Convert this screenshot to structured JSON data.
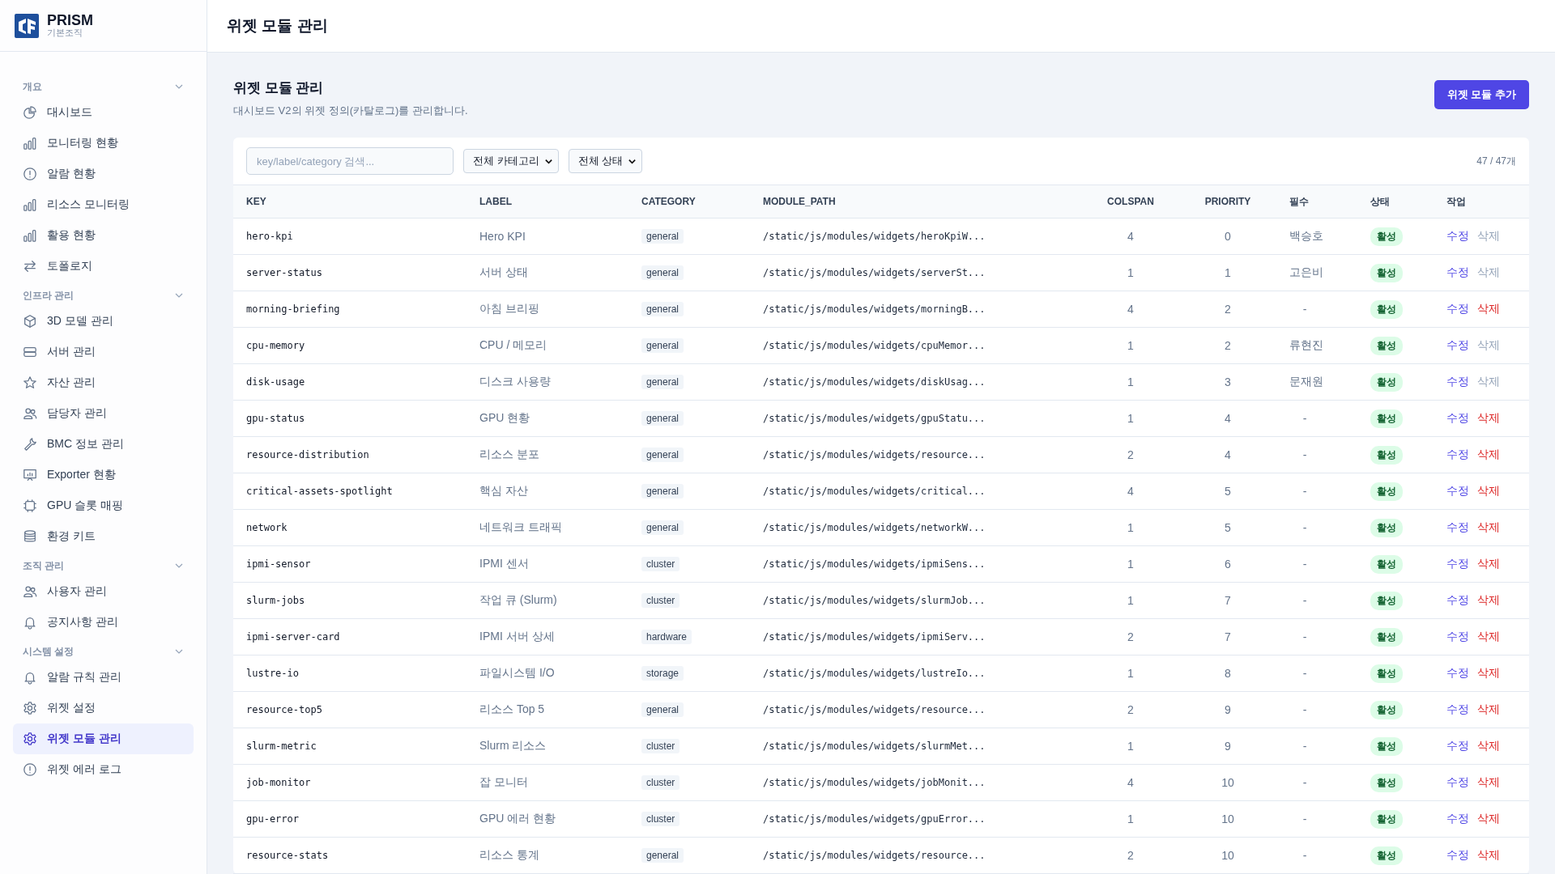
{
  "brand": {
    "name": "PRISM",
    "org": "기본조직"
  },
  "sidebar": {
    "sections": [
      {
        "title": "개요",
        "expanded": true,
        "items": [
          {
            "label": "대시보드",
            "kind": "pie",
            "selected": false
          },
          {
            "label": "모니터링 현황",
            "kind": "bars",
            "selected": false
          },
          {
            "label": "알람 현황",
            "kind": "alert",
            "selected": false
          },
          {
            "label": "리소스 모니터링",
            "kind": "bars",
            "selected": false
          },
          {
            "label": "활용 현황",
            "kind": "bars",
            "selected": false
          },
          {
            "label": "토폴로지",
            "kind": "arrows",
            "selected": false
          }
        ]
      },
      {
        "title": "인프라 관리",
        "expanded": true,
        "items": [
          {
            "label": "3D 모델 관리",
            "kind": "cube",
            "selected": false
          },
          {
            "label": "서버 관리",
            "kind": "server",
            "selected": false
          },
          {
            "label": "자산 관리",
            "kind": "star",
            "selected": false
          },
          {
            "label": "담당자 관리",
            "kind": "users",
            "selected": false
          },
          {
            "label": "BMC 정보 관리",
            "kind": "wrench",
            "selected": false
          },
          {
            "label": "Exporter 현황",
            "kind": "monitor",
            "selected": false
          },
          {
            "label": "GPU 슬롯 매핑",
            "kind": "chip",
            "selected": false
          },
          {
            "label": "환경 키트",
            "kind": "database",
            "selected": false
          }
        ]
      },
      {
        "title": "조직 관리",
        "expanded": true,
        "items": [
          {
            "label": "사용자 관리",
            "kind": "users",
            "selected": false
          },
          {
            "label": "공지사항 관리",
            "kind": "bell",
            "selected": false
          }
        ]
      },
      {
        "title": "시스템 설정",
        "expanded": true,
        "items": [
          {
            "label": "알람 규칙 관리",
            "kind": "bell",
            "selected": false
          },
          {
            "label": "위젯 설정",
            "kind": "gear",
            "selected": false
          },
          {
            "label": "위젯 모듈 관리",
            "kind": "gear",
            "selected": true
          },
          {
            "label": "위젯 에러 로그",
            "kind": "alert",
            "selected": false
          }
        ]
      }
    ]
  },
  "header": {
    "title": "위젯 모듈 관리"
  },
  "page": {
    "title": "위젯 모듈 관리",
    "description": "대시보드 V2의 위젯 정의(카탈로그)를 관리합니다.",
    "add_button": "위젯 모듈 추가"
  },
  "filters": {
    "search": {
      "placeholder": "key/label/category 검색..."
    },
    "category": "전체 카테고리",
    "status": "전체 상태",
    "count": "47 / 47개"
  },
  "table": {
    "columns": [
      "KEY",
      "LABEL",
      "CATEGORY",
      "MODULE_PATH",
      "COLSPAN",
      "PRIORITY",
      "필수",
      "상태",
      "작업"
    ],
    "rows": [
      {
        "key": "hero-kpi",
        "label": "Hero KPI",
        "category": "general",
        "module_path": "/static/js/modules/widgets/heroKpiW...",
        "colspan": "4",
        "priority": "0",
        "required": "백승호",
        "status": "활성",
        "edit": "수정",
        "delete": "삭제",
        "delete_disabled": true
      },
      {
        "key": "server-status",
        "label": "서버 상태",
        "category": "general",
        "module_path": "/static/js/modules/widgets/serverSt...",
        "colspan": "1",
        "priority": "1",
        "required": "고은비",
        "status": "활성",
        "edit": "수정",
        "delete": "삭제",
        "delete_disabled": true
      },
      {
        "key": "morning-briefing",
        "label": "아침 브리핑",
        "category": "general",
        "module_path": "/static/js/modules/widgets/morningB...",
        "colspan": "4",
        "priority": "2",
        "required": "-",
        "status": "활성",
        "edit": "수정",
        "delete": "삭제",
        "delete_disabled": false
      },
      {
        "key": "cpu-memory",
        "label": "CPU / 메모리",
        "category": "general",
        "module_path": "/static/js/modules/widgets/cpuMemor...",
        "colspan": "1",
        "priority": "2",
        "required": "류현진",
        "status": "활성",
        "edit": "수정",
        "delete": "삭제",
        "delete_disabled": true
      },
      {
        "key": "disk-usage",
        "label": "디스크 사용량",
        "category": "general",
        "module_path": "/static/js/modules/widgets/diskUsag...",
        "colspan": "1",
        "priority": "3",
        "required": "문재원",
        "status": "활성",
        "edit": "수정",
        "delete": "삭제",
        "delete_disabled": true
      },
      {
        "key": "gpu-status",
        "label": "GPU 현황",
        "category": "general",
        "module_path": "/static/js/modules/widgets/gpuStatu...",
        "colspan": "1",
        "priority": "4",
        "required": "-",
        "status": "활성",
        "edit": "수정",
        "delete": "삭제",
        "delete_disabled": false
      },
      {
        "key": "resource-distribution",
        "label": "리소스 분포",
        "category": "general",
        "module_path": "/static/js/modules/widgets/resource...",
        "colspan": "2",
        "priority": "4",
        "required": "-",
        "status": "활성",
        "edit": "수정",
        "delete": "삭제",
        "delete_disabled": false
      },
      {
        "key": "critical-assets-spotlight",
        "label": "핵심 자산",
        "category": "general",
        "module_path": "/static/js/modules/widgets/critical...",
        "colspan": "4",
        "priority": "5",
        "required": "-",
        "status": "활성",
        "edit": "수정",
        "delete": "삭제",
        "delete_disabled": false
      },
      {
        "key": "network",
        "label": "네트워크 트래픽",
        "category": "general",
        "module_path": "/static/js/modules/widgets/networkW...",
        "colspan": "1",
        "priority": "5",
        "required": "-",
        "status": "활성",
        "edit": "수정",
        "delete": "삭제",
        "delete_disabled": false
      },
      {
        "key": "ipmi-sensor",
        "label": "IPMI 센서",
        "category": "cluster",
        "module_path": "/static/js/modules/widgets/ipmiSens...",
        "colspan": "1",
        "priority": "6",
        "required": "-",
        "status": "활성",
        "edit": "수정",
        "delete": "삭제",
        "delete_disabled": false
      },
      {
        "key": "slurm-jobs",
        "label": "작업 큐 (Slurm)",
        "category": "cluster",
        "module_path": "/static/js/modules/widgets/slurmJob...",
        "colspan": "1",
        "priority": "7",
        "required": "-",
        "status": "활성",
        "edit": "수정",
        "delete": "삭제",
        "delete_disabled": false
      },
      {
        "key": "ipmi-server-card",
        "label": "IPMI 서버 상세",
        "category": "hardware",
        "module_path": "/static/js/modules/widgets/ipmiServ...",
        "colspan": "2",
        "priority": "7",
        "required": "-",
        "status": "활성",
        "edit": "수정",
        "delete": "삭제",
        "delete_disabled": false
      },
      {
        "key": "lustre-io",
        "label": "파일시스템 I/O",
        "category": "storage",
        "module_path": "/static/js/modules/widgets/lustreIo...",
        "colspan": "1",
        "priority": "8",
        "required": "-",
        "status": "활성",
        "edit": "수정",
        "delete": "삭제",
        "delete_disabled": false
      },
      {
        "key": "resource-top5",
        "label": "리소스 Top 5",
        "category": "general",
        "module_path": "/static/js/modules/widgets/resource...",
        "colspan": "2",
        "priority": "9",
        "required": "-",
        "status": "활성",
        "edit": "수정",
        "delete": "삭제",
        "delete_disabled": false
      },
      {
        "key": "slurm-metric",
        "label": "Slurm 리소스",
        "category": "cluster",
        "module_path": "/static/js/modules/widgets/slurmMet...",
        "colspan": "1",
        "priority": "9",
        "required": "-",
        "status": "활성",
        "edit": "수정",
        "delete": "삭제",
        "delete_disabled": false
      },
      {
        "key": "job-monitor",
        "label": "잡 모니터",
        "category": "cluster",
        "module_path": "/static/js/modules/widgets/jobMonit...",
        "colspan": "4",
        "priority": "10",
        "required": "-",
        "status": "활성",
        "edit": "수정",
        "delete": "삭제",
        "delete_disabled": false
      },
      {
        "key": "gpu-error",
        "label": "GPU 에러 현황",
        "category": "cluster",
        "module_path": "/static/js/modules/widgets/gpuError...",
        "colspan": "1",
        "priority": "10",
        "required": "-",
        "status": "활성",
        "edit": "수정",
        "delete": "삭제",
        "delete_disabled": false
      },
      {
        "key": "resource-stats",
        "label": "리소스 통계",
        "category": "general",
        "module_path": "/static/js/modules/widgets/resource...",
        "colspan": "2",
        "priority": "10",
        "required": "-",
        "status": "활성",
        "edit": "수정",
        "delete": "삭제",
        "delete_disabled": false
      }
    ]
  }
}
